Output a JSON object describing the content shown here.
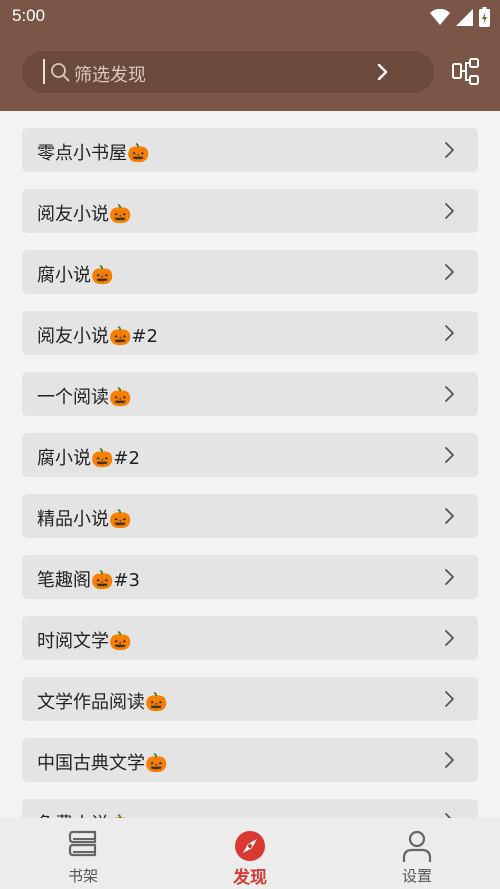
{
  "status_bar": {
    "time": "5:00"
  },
  "search": {
    "placeholder": "筛选发现"
  },
  "list": {
    "items": [
      {
        "label": "零点小书屋🎃"
      },
      {
        "label": "阅友小说🎃"
      },
      {
        "label": "腐小说🎃"
      },
      {
        "label": "阅友小说🎃#2"
      },
      {
        "label": "一个阅读🎃"
      },
      {
        "label": "腐小说🎃#2"
      },
      {
        "label": "精品小说🎃"
      },
      {
        "label": "笔趣阁🎃#3"
      },
      {
        "label": "时阅文学🎃"
      },
      {
        "label": "文学作品阅读🎃"
      },
      {
        "label": "中国古典文学🎃"
      },
      {
        "label": "免费小说🎃"
      }
    ]
  },
  "bottom_nav": {
    "bookshelf": {
      "label": "书架",
      "icon": "bookshelf-icon",
      "active": false
    },
    "discover": {
      "label": "发现",
      "icon": "compass-icon",
      "active": true
    },
    "settings": {
      "label": "设置",
      "icon": "person-icon",
      "active": false
    }
  },
  "colors": {
    "header": "#7b5546",
    "accent": "#d83a32",
    "item_bg": "#e4e4e4"
  }
}
